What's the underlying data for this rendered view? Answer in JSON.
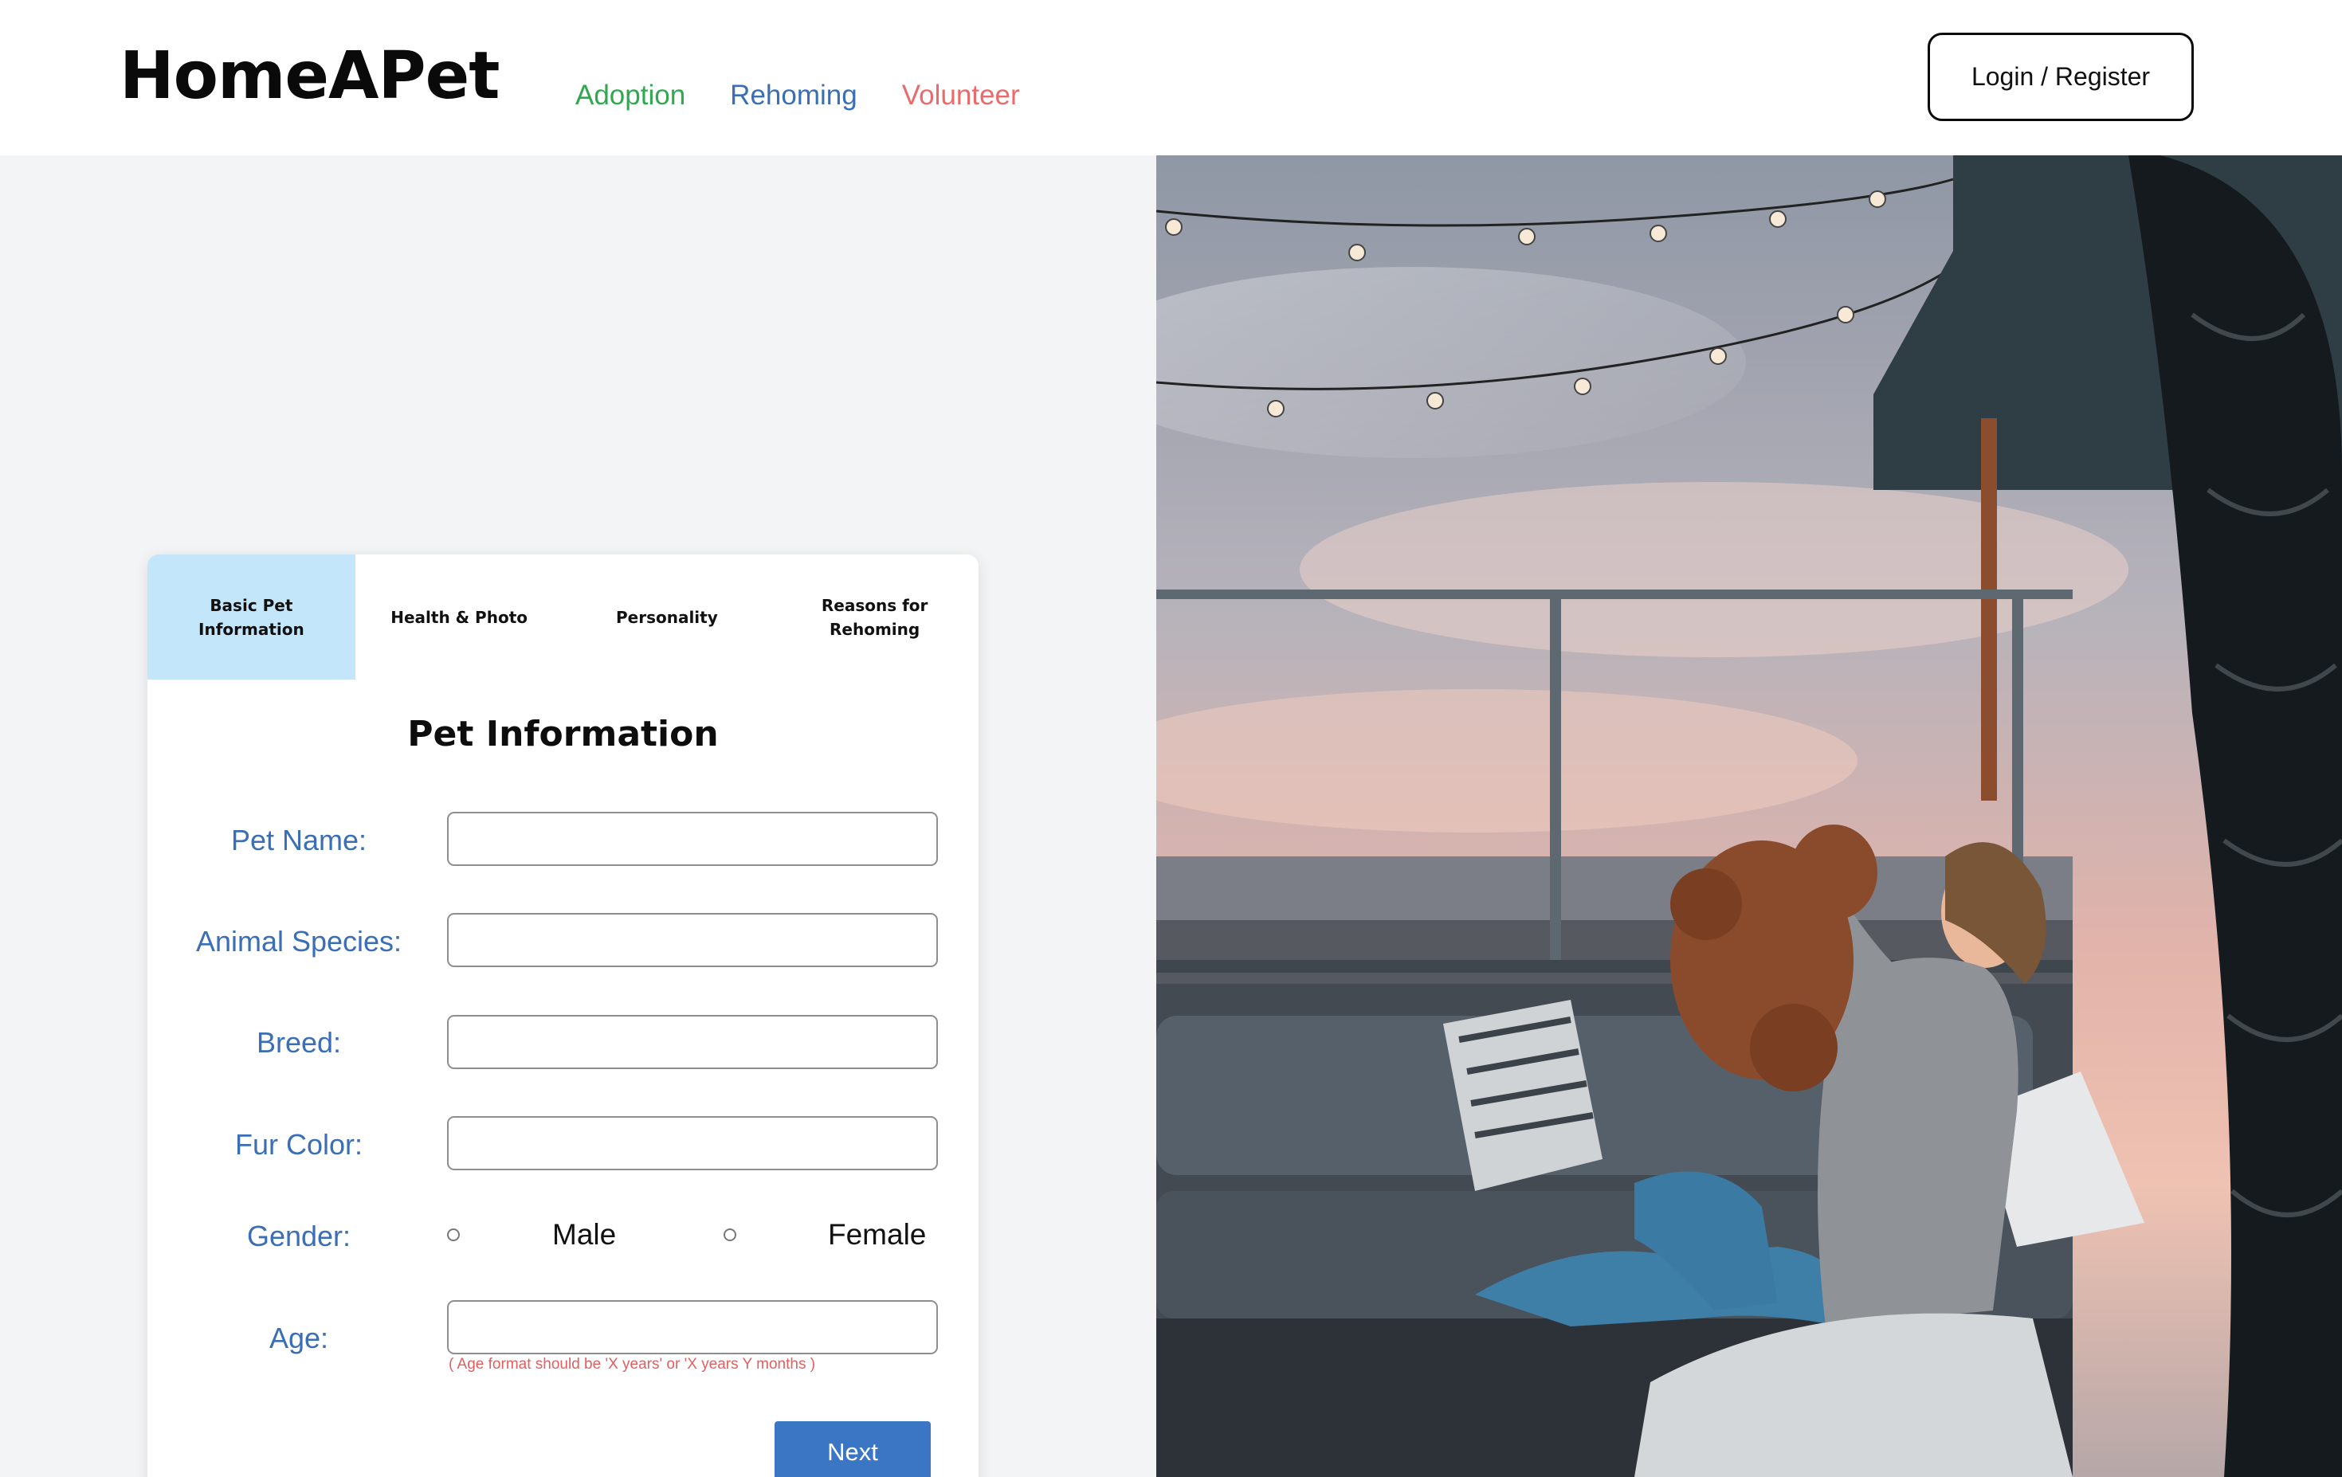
{
  "header": {
    "logo": "HomeAPet",
    "nav": [
      {
        "label": "Adoption",
        "color": "#2fa84f"
      },
      {
        "label": "Rehoming",
        "color": "#3a6eb5"
      },
      {
        "label": "Volunteer",
        "color": "#ea6b6b"
      }
    ],
    "login_label": "Login / Register"
  },
  "form": {
    "tabs": [
      {
        "label": "Basic Pet Information",
        "active": true
      },
      {
        "label": "Health & Photo",
        "active": false
      },
      {
        "label": "Personality",
        "active": false
      },
      {
        "label": "Reasons for Rehoming",
        "active": false
      }
    ],
    "title": "Pet Information",
    "fields": {
      "pet_name": {
        "label": "Pet Name:",
        "value": ""
      },
      "species": {
        "label": "Animal Species:",
        "value": ""
      },
      "breed": {
        "label": "Breed:",
        "value": ""
      },
      "fur_color": {
        "label": "Fur Color:",
        "value": ""
      },
      "gender": {
        "label": "Gender:",
        "options": [
          "Male",
          "Female"
        ],
        "selected": null
      },
      "age": {
        "label": "Age:",
        "value": "",
        "hint": "( Age format should be 'X years' or 'X years Y months )"
      }
    },
    "next_label": "Next"
  },
  "colors": {
    "accent_blue": "#3a76c4",
    "label_blue": "#3a6eb5",
    "active_tab": "#c3e6fb",
    "hint_red": "#e06060"
  },
  "photo": {
    "icon": "woman-holding-dog-photo"
  }
}
